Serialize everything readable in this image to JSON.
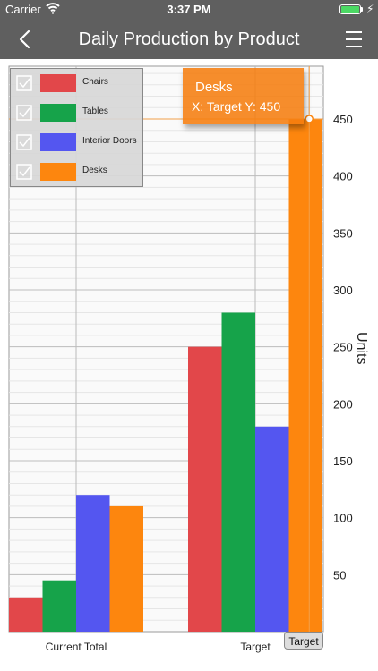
{
  "status_bar": {
    "carrier": "Carrier",
    "time": "3:37 PM",
    "wifi_icon": "wifi-icon",
    "battery_icon": "battery-icon",
    "charging_icon": "charging-icon"
  },
  "nav": {
    "title": "Daily Production by Product",
    "back_icon": "chevron-left-icon",
    "menu_icon": "hamburger-menu-icon"
  },
  "legend": {
    "items": [
      {
        "label": "Chairs",
        "color": "#e2474a",
        "checked": true
      },
      {
        "label": "Tables",
        "color": "#16a34a",
        "checked": true
      },
      {
        "label": "Interior Doors",
        "color": "#5456f0",
        "checked": true
      },
      {
        "label": "Desks",
        "color": "#fd860e",
        "checked": true
      }
    ]
  },
  "tooltip": {
    "series": "Desks",
    "text": "X: Target Y: 450"
  },
  "target_button": "Target",
  "chart_data": {
    "type": "bar",
    "categories": [
      "Current Total",
      "Target"
    ],
    "series": [
      {
        "name": "Chairs",
        "color": "#e2474a",
        "values": [
          30,
          250
        ]
      },
      {
        "name": "Tables",
        "color": "#16a34a",
        "values": [
          45,
          280
        ]
      },
      {
        "name": "Interior Doors",
        "color": "#5456f0",
        "values": [
          120,
          180
        ]
      },
      {
        "name": "Desks",
        "color": "#fd860e",
        "values": [
          110,
          450
        ]
      }
    ],
    "ylabel": "Units",
    "ylim": [
      0,
      500
    ],
    "ytick_labels": [
      "50",
      "100",
      "150",
      "200",
      "250",
      "300",
      "350",
      "400",
      "450"
    ],
    "grid": true,
    "legend_position": "top-left",
    "highlighted": {
      "series": "Desks",
      "category": "Target",
      "value": 450
    }
  }
}
